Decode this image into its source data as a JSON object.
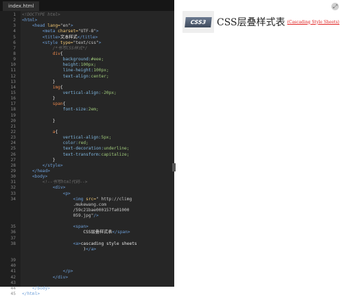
{
  "editor": {
    "tab_label": "index.html",
    "lines": [
      {
        "n": "1",
        "tokens": [
          {
            "t": "<!DOCTYPE html>",
            "c": "t-cmt"
          }
        ]
      },
      {
        "n": "2",
        "tokens": [
          {
            "t": "<html>",
            "c": "t-tag"
          }
        ]
      },
      {
        "n": "3",
        "tokens": [
          {
            "t": "    <head ",
            "c": "t-tag"
          },
          {
            "t": "lang=",
            "c": "t-attr"
          },
          {
            "t": "\"en\"",
            "c": "t-str"
          },
          {
            "t": ">",
            "c": "t-tag"
          }
        ]
      },
      {
        "n": "4",
        "tokens": [
          {
            "t": "        <meta ",
            "c": "t-tag"
          },
          {
            "t": "charset=",
            "c": "t-attr"
          },
          {
            "t": "\"UTF-8\"",
            "c": "t-str"
          },
          {
            "t": ">",
            "c": "t-tag"
          }
        ]
      },
      {
        "n": "5",
        "tokens": [
          {
            "t": "        <title>",
            "c": "t-tag"
          },
          {
            "t": "文本样式",
            "c": "t-txt"
          },
          {
            "t": "</title>",
            "c": "t-tag"
          }
        ]
      },
      {
        "n": "6",
        "tokens": [
          {
            "t": "        <style ",
            "c": "t-tag"
          },
          {
            "t": "type=",
            "c": "t-attr"
          },
          {
            "t": "\"text/css\"",
            "c": "t-str"
          },
          {
            "t": ">",
            "c": "t-tag"
          }
        ]
      },
      {
        "n": "7",
        "tokens": [
          {
            "t": "            /*书写CSS样式*/",
            "c": "t-cmt"
          }
        ]
      },
      {
        "n": "8",
        "tokens": [
          {
            "t": "            div",
            "c": "t-sel"
          },
          {
            "t": "{",
            "c": "t-txt"
          }
        ]
      },
      {
        "n": "9",
        "tokens": [
          {
            "t": "                background:",
            "c": "t-prop"
          },
          {
            "t": "#eee;",
            "c": "t-val"
          }
        ]
      },
      {
        "n": "10",
        "tokens": [
          {
            "t": "                height:",
            "c": "t-prop"
          },
          {
            "t": "100px;",
            "c": "t-val"
          }
        ]
      },
      {
        "n": "11",
        "tokens": [
          {
            "t": "                line-height:",
            "c": "t-prop"
          },
          {
            "t": "100px;",
            "c": "t-val"
          }
        ]
      },
      {
        "n": "12",
        "tokens": [
          {
            "t": "                text-align:",
            "c": "t-prop"
          },
          {
            "t": "center;",
            "c": "t-val"
          }
        ]
      },
      {
        "n": "13",
        "tokens": [
          {
            "t": "            }",
            "c": "t-txt"
          }
        ]
      },
      {
        "n": "14",
        "tokens": [
          {
            "t": "            img",
            "c": "t-sel"
          },
          {
            "t": "{",
            "c": "t-txt"
          }
        ]
      },
      {
        "n": "15",
        "tokens": [
          {
            "t": "                vertical-align:",
            "c": "t-prop"
          },
          {
            "t": "-20px;",
            "c": "t-val"
          }
        ]
      },
      {
        "n": "16",
        "tokens": [
          {
            "t": "            }",
            "c": "t-txt"
          }
        ]
      },
      {
        "n": "17",
        "tokens": [
          {
            "t": "            span",
            "c": "t-sel"
          },
          {
            "t": "{",
            "c": "t-txt"
          }
        ]
      },
      {
        "n": "18",
        "tokens": [
          {
            "t": "                font-size:",
            "c": "t-prop"
          },
          {
            "t": "2em;",
            "c": "t-val"
          }
        ]
      },
      {
        "n": "19",
        "tokens": []
      },
      {
        "n": "20",
        "tokens": [
          {
            "t": "            }",
            "c": "t-txt"
          }
        ]
      },
      {
        "n": "21",
        "tokens": []
      },
      {
        "n": "22",
        "tokens": [
          {
            "t": "            a",
            "c": "t-sel"
          },
          {
            "t": "{",
            "c": "t-txt"
          }
        ]
      },
      {
        "n": "23",
        "tokens": [
          {
            "t": "                vertical-align:",
            "c": "t-prop"
          },
          {
            "t": "5px;",
            "c": "t-val"
          }
        ]
      },
      {
        "n": "24",
        "tokens": [
          {
            "t": "                color:",
            "c": "t-prop"
          },
          {
            "t": "red;",
            "c": "t-val"
          }
        ]
      },
      {
        "n": "25",
        "tokens": [
          {
            "t": "                text-decoration:",
            "c": "t-prop"
          },
          {
            "t": "underline;",
            "c": "t-val"
          }
        ]
      },
      {
        "n": "26",
        "tokens": [
          {
            "t": "                text-transform:",
            "c": "t-prop"
          },
          {
            "t": "capitalize;",
            "c": "t-val"
          }
        ]
      },
      {
        "n": "27",
        "tokens": [
          {
            "t": "            }",
            "c": "t-txt"
          }
        ]
      },
      {
        "n": "28",
        "tokens": [
          {
            "t": "        </style>",
            "c": "t-tag"
          }
        ]
      },
      {
        "n": "29",
        "tokens": [
          {
            "t": "    </head>",
            "c": "t-tag"
          }
        ]
      },
      {
        "n": "30",
        "tokens": [
          {
            "t": "    <body>",
            "c": "t-tag"
          }
        ]
      },
      {
        "n": "31",
        "tokens": [
          {
            "t": "        <!--书写html代码-->",
            "c": "t-cmt"
          }
        ]
      },
      {
        "n": "32",
        "tokens": [
          {
            "t": "            <div>",
            "c": "t-tag"
          }
        ]
      },
      {
        "n": "33",
        "tokens": [
          {
            "t": "                <p>",
            "c": "t-tag"
          }
        ]
      },
      {
        "n": "34",
        "tokens": [
          {
            "t": "                    <img ",
            "c": "t-tag"
          },
          {
            "t": "src=",
            "c": "t-attr"
          },
          {
            "t": "\" http://climg",
            "c": "t-str"
          }
        ]
      },
      {
        "n": "",
        "tokens": [
          {
            "t": "                    .mukewang.com",
            "c": "t-str"
          }
        ]
      },
      {
        "n": "",
        "tokens": [
          {
            "t": "                    /59c21bae000157fa01000",
            "c": "t-str"
          }
        ]
      },
      {
        "n": "",
        "tokens": [
          {
            "t": "                    059.jpg\"",
            "c": "t-str"
          },
          {
            "t": "/>",
            "c": "t-tag"
          }
        ]
      },
      {
        "n": "",
        "tokens": []
      },
      {
        "n": "35",
        "tokens": [
          {
            "t": "                    <span>",
            "c": "t-tag"
          }
        ]
      },
      {
        "n": "36",
        "tokens": [
          {
            "t": "                        CSS层叠样式表",
            "c": "t-txt"
          },
          {
            "t": "</span>",
            "c": "t-tag"
          }
        ]
      },
      {
        "n": "37",
        "tokens": []
      },
      {
        "n": "38",
        "tokens": [
          {
            "t": "                    <a>",
            "c": "t-tag"
          },
          {
            "t": "cascading style sheets",
            "c": "t-txt"
          }
        ]
      },
      {
        "n": "",
        "tokens": [
          {
            "t": "                        )",
            "c": "t-txt"
          },
          {
            "t": "</a>",
            "c": "t-tag"
          }
        ]
      },
      {
        "n": "",
        "tokens": []
      },
      {
        "n": "39",
        "tokens": []
      },
      {
        "n": "40",
        "tokens": []
      },
      {
        "n": "41",
        "tokens": [
          {
            "t": "                </p>",
            "c": "t-tag"
          }
        ]
      },
      {
        "n": "42",
        "tokens": [
          {
            "t": "            </div>",
            "c": "t-tag"
          }
        ]
      },
      {
        "n": "43",
        "tokens": []
      },
      {
        "n": "44",
        "tokens": [
          {
            "t": "    </body>",
            "c": "t-tag"
          }
        ]
      },
      {
        "n": "45",
        "tokens": [
          {
            "t": "</html>",
            "c": "t-tag"
          }
        ]
      }
    ]
  },
  "preview": {
    "logo_text": "CSS3",
    "heading": "CSS层叠样式表",
    "link_text": "(Cascading Style Sheets)",
    "expand_glyph": "⤢"
  }
}
